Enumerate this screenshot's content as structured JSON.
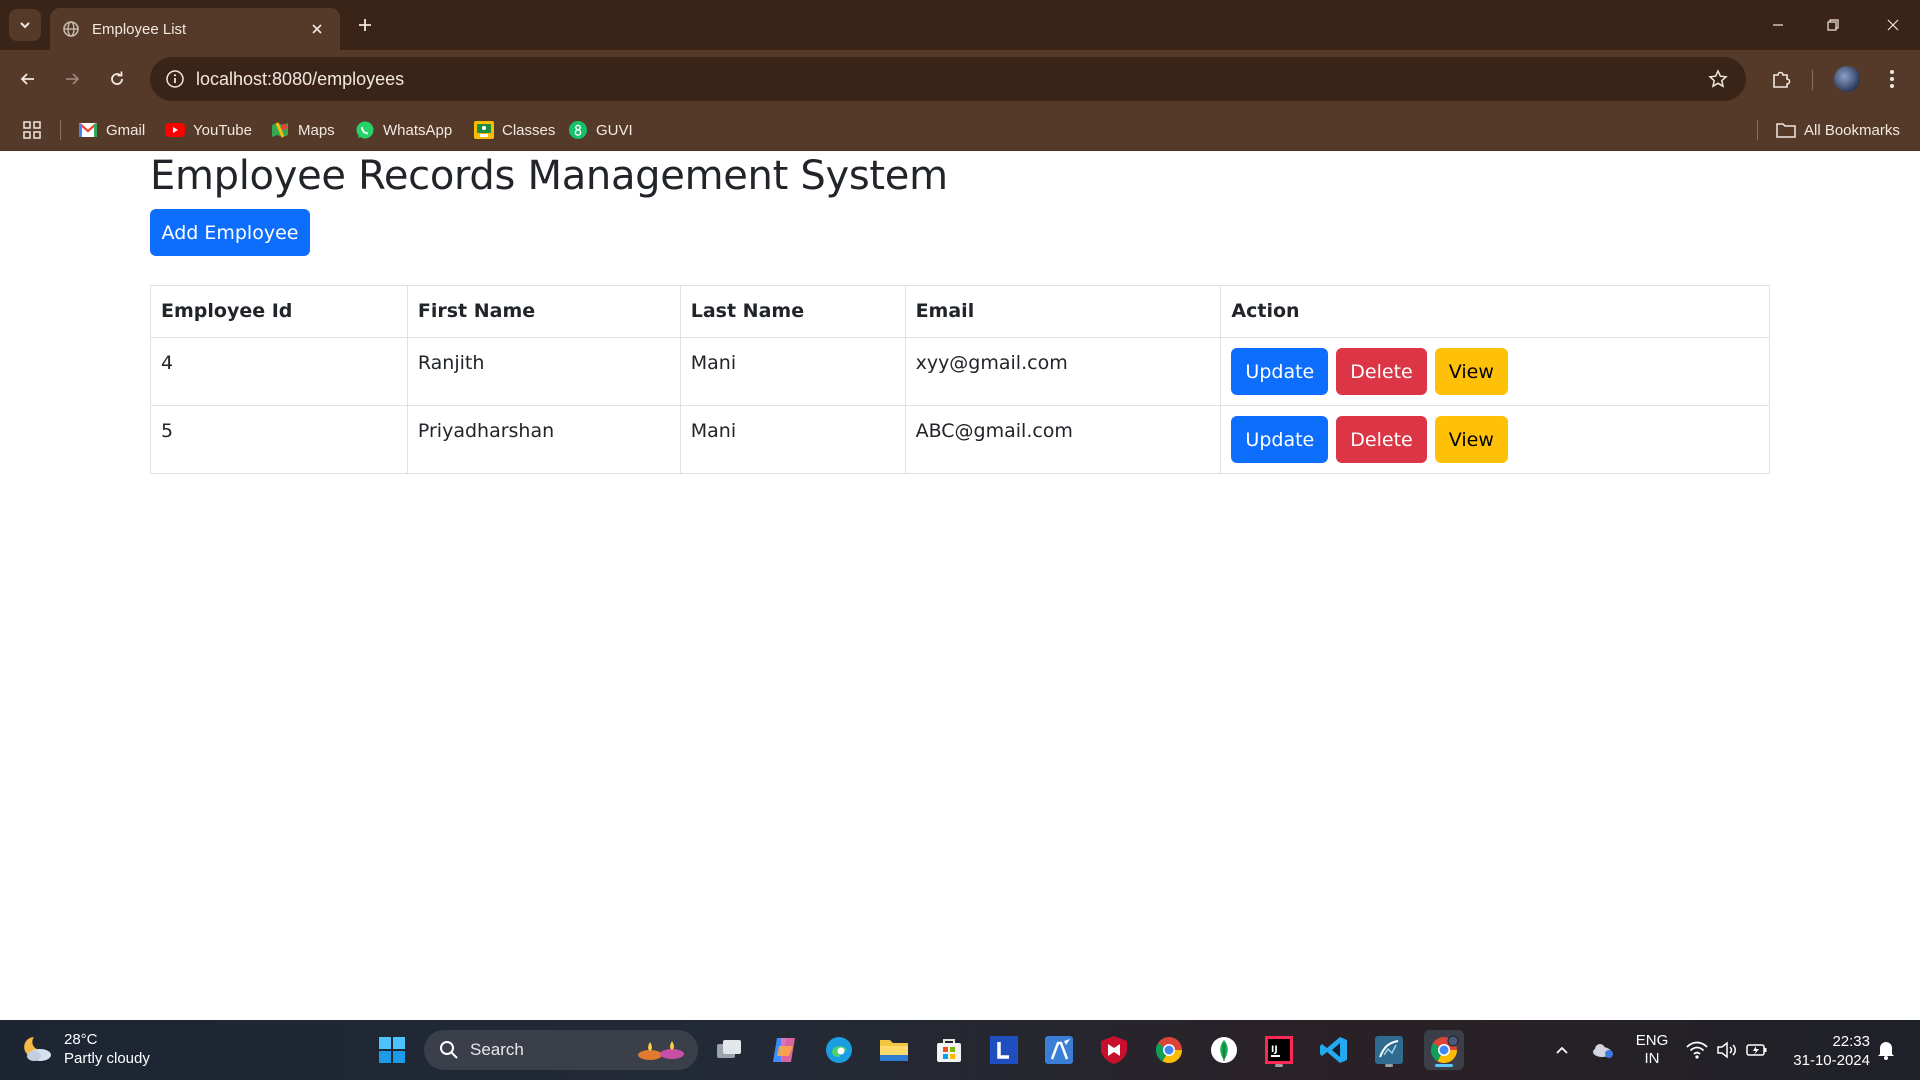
{
  "browser": {
    "tab_title": "Employee List",
    "url": "localhost:8080/employees",
    "bookmarks": [
      {
        "label": "Gmail",
        "icon": "gmail-icon"
      },
      {
        "label": "YouTube",
        "icon": "youtube-icon"
      },
      {
        "label": "Maps",
        "icon": "maps-icon"
      },
      {
        "label": "WhatsApp",
        "icon": "whatsapp-icon"
      },
      {
        "label": "Classes",
        "icon": "classes-icon"
      },
      {
        "label": "GUVI",
        "icon": "guvi-icon"
      }
    ],
    "all_bookmarks_label": "All Bookmarks"
  },
  "page": {
    "title": "Employee Records Management System",
    "add_button_label": "Add Employee"
  },
  "table": {
    "headers": [
      "Employee Id",
      "First Name",
      "Last Name",
      "Email",
      "Action"
    ],
    "rows": [
      {
        "id": "4",
        "first_name": "Ranjith",
        "last_name": "Mani",
        "email": "xyy@gmail.com"
      },
      {
        "id": "5",
        "first_name": "Priyadharshan",
        "last_name": "Mani",
        "email": "ABC@gmail.com"
      }
    ],
    "actions": {
      "update": "Update",
      "delete": "Delete",
      "view": "View"
    }
  },
  "colors": {
    "primary": "#0d6efd",
    "danger": "#dc3545",
    "warning": "#ffc107",
    "chrome_dark": "#3a2418",
    "chrome_light": "#553a2a"
  },
  "taskbar": {
    "weather_temp": "28°C",
    "weather_desc": "Partly cloudy",
    "search_label": "Search",
    "language_line1": "ENG",
    "language_line2": "IN",
    "time": "22:33",
    "date": "31-10-2024"
  }
}
